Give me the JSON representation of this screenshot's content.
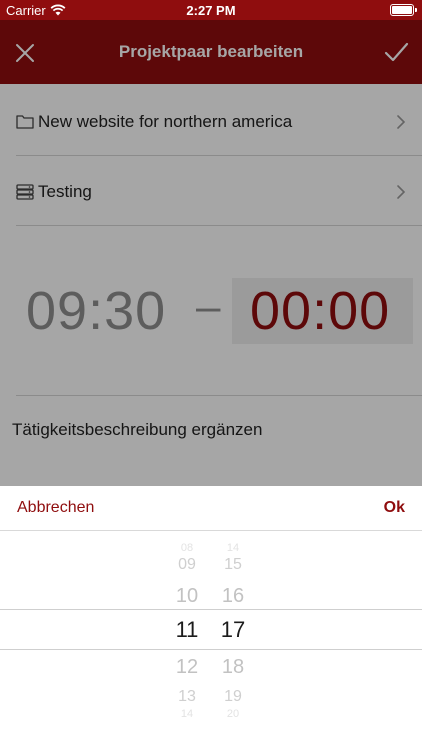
{
  "status_bar": {
    "carrier": "Carrier",
    "time": "2:27 PM"
  },
  "nav_bar": {
    "title": "Projektpaar bearbeiten",
    "close_icon": "close-icon",
    "confirm_icon": "checkmark-icon",
    "background_color": "#8f0d0e"
  },
  "form": {
    "project_label": "New website for northern america",
    "task_label": "Testing",
    "start_time": "09:30",
    "range_separator": "–",
    "end_time": "00:00",
    "description_placeholder": "Tätigkeitsbeschreibung ergänzen"
  },
  "picker": {
    "cancel_label": "Abbrechen",
    "ok_label": "Ok",
    "hours": [
      "08",
      "09",
      "10",
      "11",
      "12",
      "13",
      "14"
    ],
    "minutes": [
      "14",
      "15",
      "16",
      "17",
      "18",
      "19",
      "20"
    ],
    "selected_hour": "11",
    "selected_minute": "17"
  },
  "colors": {
    "accent": "#8f0d0e",
    "text_muted": "#8f8f8f"
  }
}
